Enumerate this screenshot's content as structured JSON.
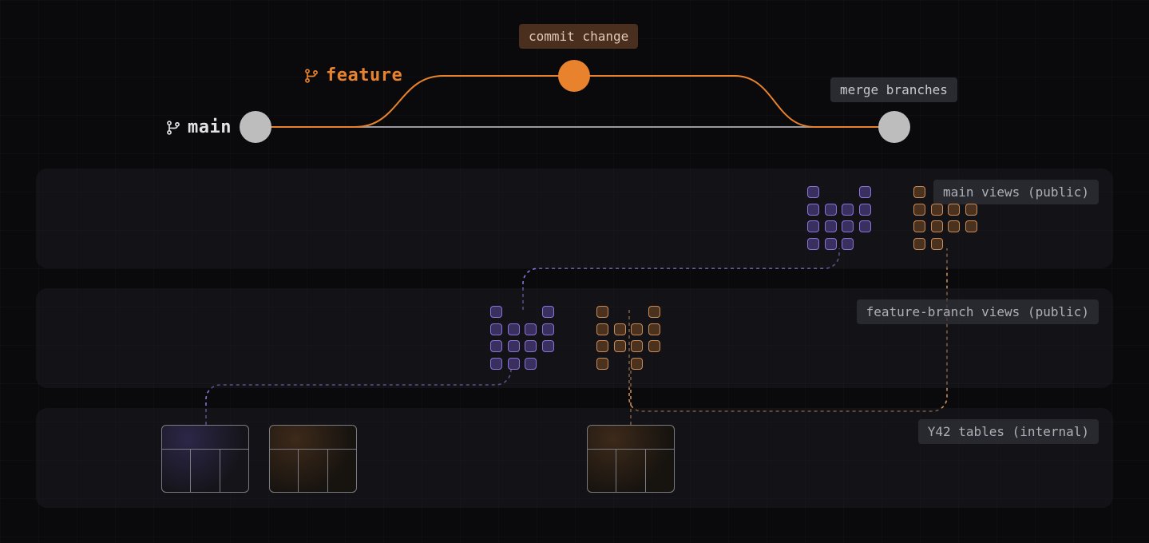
{
  "labels": {
    "commit": "commit change",
    "merge": "merge branches",
    "feature_branch": "feature",
    "main_branch": "main"
  },
  "panels": {
    "main_views": "main views (public)",
    "feature_views": "feature-branch views (public)",
    "tables": "Y42 tables (internal)"
  },
  "colors": {
    "orange": "#e8822c",
    "purple": "#8b73d8",
    "gray_dot": "#bdbdbd",
    "panel_bg": "rgba(30,30,36,0.45)"
  }
}
